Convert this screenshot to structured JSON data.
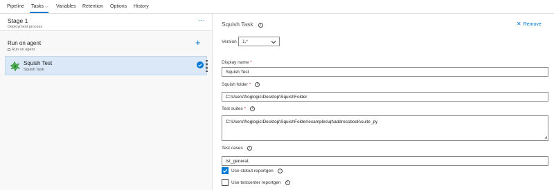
{
  "tabs": [
    {
      "label": "Pipeline"
    },
    {
      "label": "Tasks"
    },
    {
      "label": "Variables"
    },
    {
      "label": "Retention"
    },
    {
      "label": "Options"
    },
    {
      "label": "History"
    }
  ],
  "tasks_chevron": "⌵",
  "left": {
    "stage": {
      "title": "Stage 1",
      "subtitle": "Deployment process",
      "more": "···"
    },
    "agent": {
      "title": "Run on agent",
      "subtitle": "Run on agent",
      "add": "+"
    },
    "task": {
      "title": "Squish Test",
      "subtitle": "Squish Task",
      "icon": "squish-logo-icon",
      "status_icon": "check-circle-icon"
    }
  },
  "right": {
    "title": "Squish Task",
    "remove_label": "Remove",
    "version": {
      "label": "Version",
      "value": "1.*"
    },
    "display_name": {
      "label": "Display name",
      "required": "*",
      "value": "Squish Test"
    },
    "squish_folder": {
      "label": "Squish folder",
      "required": "*",
      "value": "C:\\Users\\froglogic\\Desktop\\SquishFolder"
    },
    "test_suites": {
      "label": "Test suites",
      "required": "*",
      "value": "C:\\Users\\froglogic\\Desktop\\SquishFolder\\examples\\qt\\addressbook\\suite_py"
    },
    "test_cases": {
      "label": "Test cases",
      "value": "tst_general;"
    },
    "stdout_reportgen": {
      "label": "Use stdout reportgen",
      "checked": true
    },
    "testcenter_reportgen": {
      "label": "Use testcenter reportgen",
      "checked": false
    }
  },
  "colors": {
    "accent": "#0078d4",
    "selected_row": "#dbe8f8",
    "required": "#d13438"
  }
}
